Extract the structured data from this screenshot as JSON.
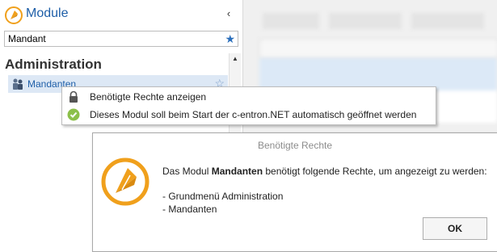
{
  "sidebar": {
    "title": "Module",
    "search": {
      "value": "Mandant"
    },
    "section": "Administration",
    "item": {
      "label": "Mandanten"
    }
  },
  "context_menu": {
    "items": [
      {
        "label": "Benötigte Rechte anzeigen",
        "icon": "lock-icon"
      },
      {
        "label": "Dieses Modul soll beim Start der c-entron.NET automatisch geöffnet werden",
        "icon": "checkmark-icon"
      }
    ]
  },
  "dialog": {
    "title": "Benötigte Rechte",
    "message_prefix": "Das Modul ",
    "module_name": "Mandanten",
    "message_suffix": " benötigt folgende Rechte, um angezeigt zu werden:",
    "rights": [
      "- Grundmenü Administration",
      "- Mandanten"
    ],
    "ok_label": "OK"
  },
  "colors": {
    "accent": "#1f5fa8",
    "brand_orange": "#f0a01c",
    "selection": "#dde8f5"
  }
}
